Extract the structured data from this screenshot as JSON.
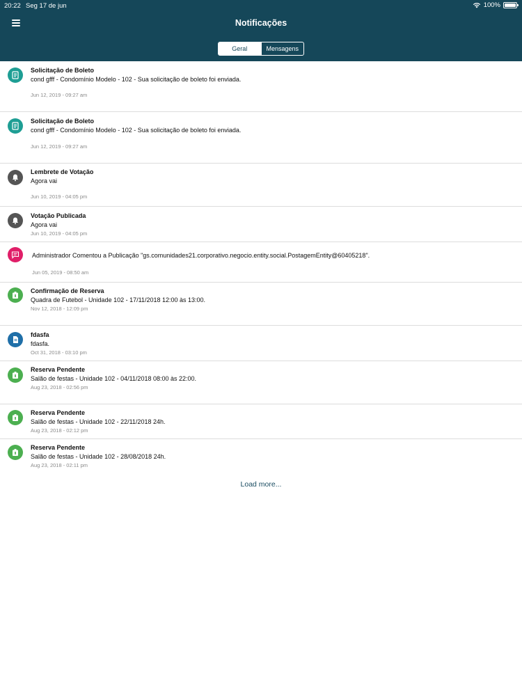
{
  "status_bar": {
    "time": "20:22",
    "date": "Seg 17 de jun",
    "battery": "100%"
  },
  "header": {
    "title": "Notificações"
  },
  "tabs": [
    {
      "label": "Geral",
      "active": true
    },
    {
      "label": "Mensagens",
      "active": false
    }
  ],
  "notifications": [
    {
      "icon": "boleto-icon",
      "color": "#1e9e94",
      "title": "Solicitação de Boleto",
      "body": "cond gfff - Condomínio Modelo - 102 - Sua solicitação de boleto foi enviada.",
      "date": "Jun 12, 2019 - 09:27 am"
    },
    {
      "icon": "boleto-icon",
      "color": "#1e9e94",
      "title": "Solicitação de Boleto",
      "body": "cond gfff - Condomínio Modelo - 102 - Sua solicitação de boleto foi enviada.",
      "date": "Jun 12, 2019 - 09:27 am"
    },
    {
      "icon": "bell-icon",
      "color": "#555555",
      "title": "Lembrete de Votação",
      "body": "Agora vai",
      "date": "Jun 10, 2019 - 04:05 pm"
    },
    {
      "icon": "bell-icon",
      "color": "#555555",
      "title": "Votação Publicada",
      "body": "Agora vai",
      "date": "Jun 10, 2019 - 04:05 pm"
    },
    {
      "icon": "comment-icon",
      "color": "#e01e68",
      "title": "",
      "body": "Administrador Comentou a Publicação \"gs.comunidades21.corporativo.negocio.entity.social.PostagemEntity@60405218\".",
      "date": "Jun 05, 2019 - 08:50 am"
    },
    {
      "icon": "reservation-icon",
      "color": "#4caf50",
      "title": "Confirmação de Reserva",
      "body": "Quadra de Futebol - Unidade 102 - 17/11/2018 12:00 às 13:00.",
      "date": "Nov 12, 2018 - 12:09 pm"
    },
    {
      "icon": "document-icon",
      "color": "#1f6fa8",
      "title": "fdasfa",
      "body": "fdasfa.",
      "date": "Oct 31, 2018 - 03:10 pm"
    },
    {
      "icon": "reservation-icon",
      "color": "#4caf50",
      "title": "Reserva Pendente",
      "body": "Salão de festas - Unidade 102 - 04/11/2018 08:00 às 22:00.",
      "date": "Aug 23, 2018 - 02:56 pm"
    },
    {
      "icon": "reservation-icon",
      "color": "#4caf50",
      "title": "Reserva Pendente",
      "body": "Salão de festas - Unidade 102 - 22/11/2018 24h.",
      "date": "Aug 23, 2018 - 02:12 pm"
    },
    {
      "icon": "reservation-icon",
      "color": "#4caf50",
      "title": "Reserva Pendente",
      "body": "Salão de festas - Unidade 102 - 28/08/2018 24h.",
      "date": "Aug 23, 2018 - 02:11 pm"
    }
  ],
  "load_more": "Load more..."
}
